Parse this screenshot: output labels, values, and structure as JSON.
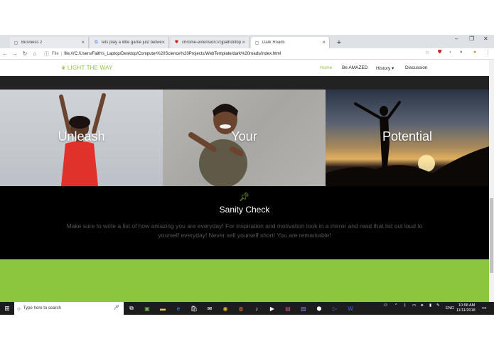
{
  "tabs": [
    {
      "title": "Business 2",
      "active": false
    },
    {
      "title": "lets play a little game just betwe",
      "active": false
    },
    {
      "title": "chrome-extension://cjpalhdnlbp",
      "active": false
    },
    {
      "title": "Dark Roads",
      "active": true
    }
  ],
  "address": {
    "scheme_label": "File",
    "url": "file:///C:/Users/Faith's_Laptop/Desktop/Computer%20Science%20Projects/WebTemplate/dark%20roads/index.html"
  },
  "site": {
    "brand": "LIGHT THE WAY",
    "nav": [
      "Home",
      "Be AMAZED",
      "History ▾",
      "Discussion"
    ],
    "hero_words": [
      "Unleash",
      "Your",
      "Potential"
    ],
    "sanity_title": "Sanity Check",
    "sanity_body": "Make sure to write a list of how amazing you are everyday! For inspiration and motivation look in a mirror and read that list out loud to yourself everyday! Never sell yourself short! You are remarkable!"
  },
  "taskbar": {
    "search_placeholder": "Type here to search",
    "language": "ENG",
    "time": "10:58 AM",
    "date": "11/11/2018"
  },
  "colors": {
    "accent_green": "#8cc63e",
    "dark": "#000000"
  }
}
